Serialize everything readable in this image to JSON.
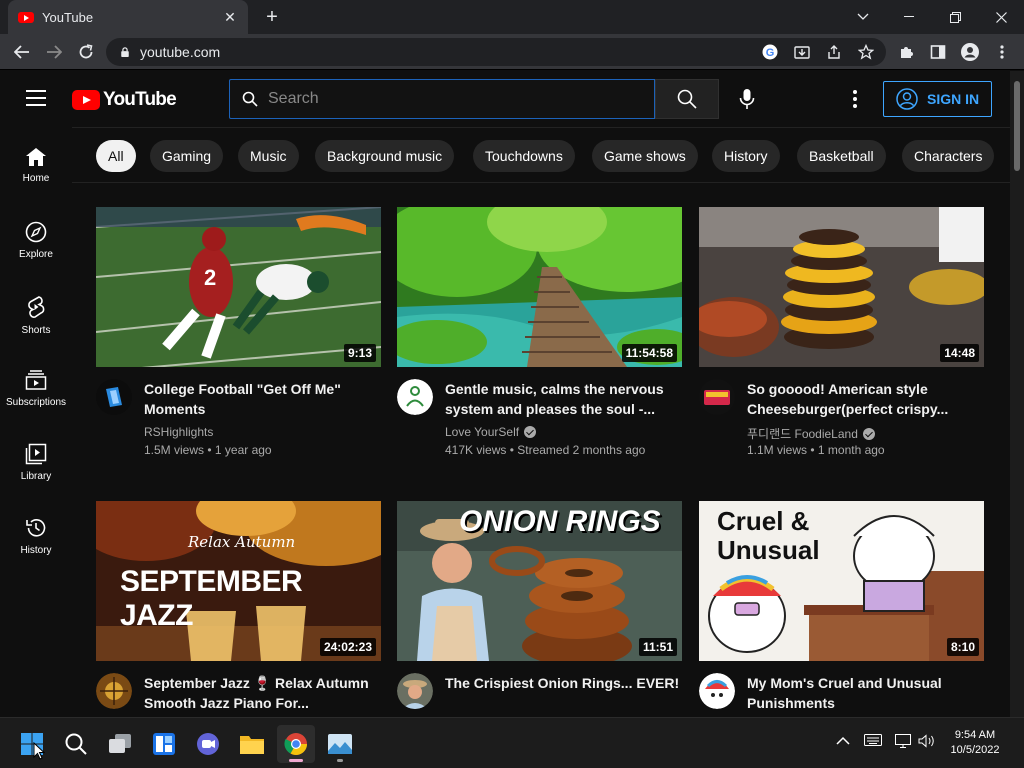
{
  "browser": {
    "tab_title": "YouTube",
    "url": "youtube.com"
  },
  "header": {
    "logo_text": "YouTube",
    "search_placeholder": "Search",
    "signin_label": "SIGN IN"
  },
  "sidebar": {
    "items": [
      {
        "label": "Home",
        "icon": "home-icon"
      },
      {
        "label": "Explore",
        "icon": "compass-icon"
      },
      {
        "label": "Shorts",
        "icon": "shorts-icon"
      },
      {
        "label": "Subscriptions",
        "icon": "subscriptions-icon"
      },
      {
        "label": "Library",
        "icon": "library-icon"
      },
      {
        "label": "History",
        "icon": "history-icon"
      }
    ]
  },
  "chips": [
    "All",
    "Gaming",
    "Music",
    "Background music",
    "Touchdowns",
    "Game shows",
    "History",
    "Basketball",
    "Characters"
  ],
  "videos": [
    {
      "title": "College Football \"Get Off Me\" Moments",
      "channel": "RSHighlights",
      "verified": false,
      "stats": "1.5M views • 1 year ago",
      "duration": "9:13"
    },
    {
      "title": "Gentle music, calms the nervous system and pleases the soul -...",
      "channel": "Love YourSelf",
      "verified": true,
      "stats": "417K views • Streamed 2 months ago",
      "duration": "11:54:58"
    },
    {
      "title": "So gooood! American style Cheeseburger(perfect crispy...",
      "channel": "푸디랜드 FoodieLand",
      "verified": true,
      "stats": "1.1M views • 1 month ago",
      "duration": "14:48"
    },
    {
      "title": "September Jazz 🍷 Relax Autumn Smooth Jazz Piano For...",
      "channel": "",
      "verified": false,
      "stats": "",
      "duration": "24:02:23",
      "thumb_text_small": "Relax Autumn",
      "thumb_text_big": "SEPTEMBER JAZZ"
    },
    {
      "title": "The Crispiest Onion Rings... EVER!",
      "channel": "",
      "verified": false,
      "stats": "",
      "duration": "11:51",
      "thumb_text_big": "ONION RINGS"
    },
    {
      "title": "My Mom's Cruel and Unusual Punishments",
      "channel": "",
      "verified": false,
      "stats": "",
      "duration": "8:10",
      "thumb_text_big": "Cruel & Unusual"
    }
  ],
  "taskbar": {
    "time": "9:54 AM",
    "date": "10/5/2022"
  },
  "colors": {
    "background": "#0f0f0f",
    "accent_blue": "#3ea6ff",
    "youtube_red": "#ff0000",
    "chip_bg": "#272727"
  }
}
